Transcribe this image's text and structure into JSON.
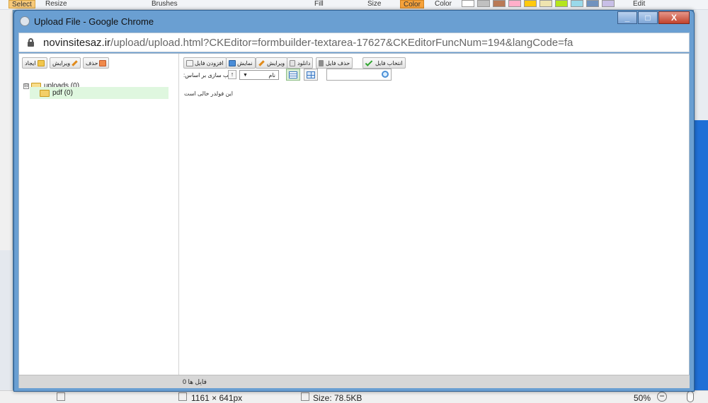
{
  "background": {
    "ribbon": {
      "select_label": "Select",
      "resize_label": "Resize",
      "brushes_label": "Brushes",
      "fill_label": "Fill",
      "size_label": "Size",
      "color1_label": "Color",
      "color2_label": "Color",
      "edit_label": "Edit"
    },
    "status": {
      "dimensions": "1161 × 641px",
      "size": "Size: 78.5KB",
      "zoom": "50%"
    }
  },
  "window": {
    "title": "Upload File - Google Chrome",
    "buttons": {
      "minimize": "_",
      "maximize": "□",
      "close": "X"
    },
    "url_host": "novinsitesaz.ir",
    "url_path": "/upload/upload.html?CKEditor=formbuilder-textarea-17627&CKEditorFuncNum=194&langCode=fa"
  },
  "left_toolbar": {
    "delete": "حذف",
    "edit": "ویرایش",
    "create": "ایجاد"
  },
  "tree": {
    "root": {
      "expander": "⊟",
      "label": "uploads (0)"
    },
    "child": {
      "label": "pdf (0)"
    }
  },
  "file_toolbar": {
    "select_file": "انتخاب فایل",
    "delete_file": "حذف فایل",
    "download": "دانلود",
    "edit": "ویرایش",
    "view": "نمایش",
    "add_file": "افزودن فایل"
  },
  "sort": {
    "label": ":مرتب سازی بر اساس",
    "direction": "↑",
    "selected": "نام"
  },
  "search": {
    "placeholder": ""
  },
  "empty_message": "این فولدر خالی است",
  "status_bar": {
    "text": "فایل ها 0"
  }
}
